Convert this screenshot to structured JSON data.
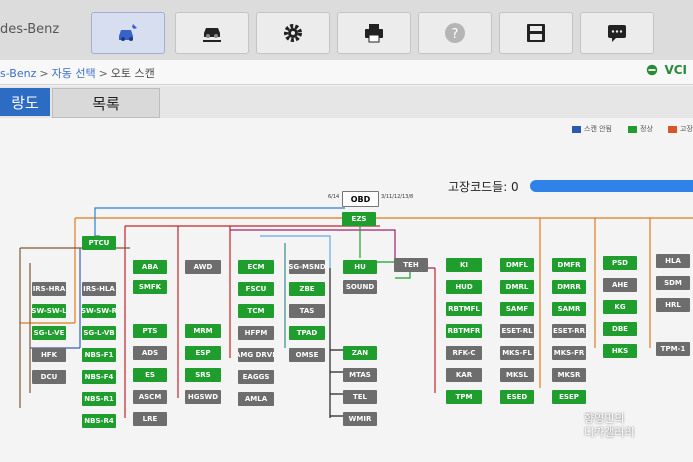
{
  "app": {
    "brand_text": "des-Benz"
  },
  "toolbar": {
    "buttons": [
      {
        "icon": "car-diagnostic-icon",
        "active": true
      },
      {
        "icon": "car-lift-icon",
        "active": false
      },
      {
        "icon": "gear-icon",
        "active": false
      },
      {
        "icon": "printer-icon",
        "active": false
      },
      {
        "icon": "help-icon",
        "active": false
      },
      {
        "icon": "save-icon",
        "active": false
      },
      {
        "icon": "chat-icon",
        "active": false
      }
    ]
  },
  "breadcrumb": {
    "items": [
      "s-Benz",
      "자동 선택",
      "오토 스캔"
    ],
    "separator": ">",
    "vci_label": "VCI"
  },
  "tabs": [
    {
      "label": "랑도"
    },
    {
      "label": "목록"
    }
  ],
  "fault_codes": {
    "label": "고장코드들: 0"
  },
  "legend": [
    {
      "label": "스캔 안됨",
      "color": "#2a5bb0"
    },
    {
      "label": "정상",
      "color": "#1f9e2e"
    },
    {
      "label": "고장",
      "color": "#d9552b"
    }
  ],
  "obd": {
    "label": "OBD",
    "left_pins": "6/14",
    "right_pins": "3/11/12/13/8"
  },
  "modules": [
    {
      "label": "EZS",
      "color": "g"
    },
    {
      "label": "PTCU",
      "color": "g"
    },
    {
      "label": "IRS-HRA",
      "color": "d"
    },
    {
      "label": "SW-SW-L",
      "color": "g"
    },
    {
      "label": "SG-L-VE",
      "color": "g"
    },
    {
      "label": "HFK",
      "color": "d"
    },
    {
      "label": "DCU",
      "color": "d"
    },
    {
      "label": "IRS-HLA",
      "color": "d"
    },
    {
      "label": "SW-SW-R",
      "color": "g"
    },
    {
      "label": "SG-L-VB",
      "color": "g"
    },
    {
      "label": "NBS-F1",
      "color": "g"
    },
    {
      "label": "NBS-F4",
      "color": "g"
    },
    {
      "label": "NBS-R1",
      "color": "g"
    },
    {
      "label": "NBS-R4",
      "color": "g"
    },
    {
      "label": "ABA",
      "color": "g"
    },
    {
      "label": "SMFK",
      "color": "g"
    },
    {
      "label": "PTS",
      "color": "g"
    },
    {
      "label": "ADS",
      "color": "d"
    },
    {
      "label": "ES",
      "color": "g"
    },
    {
      "label": "ASCM",
      "color": "d"
    },
    {
      "label": "LRE",
      "color": "d"
    },
    {
      "label": "AWD",
      "color": "d"
    },
    {
      "label": "MRM",
      "color": "g"
    },
    {
      "label": "ESP",
      "color": "g"
    },
    {
      "label": "SRS",
      "color": "g"
    },
    {
      "label": "HGSWD",
      "color": "d"
    },
    {
      "label": "ECM",
      "color": "g"
    },
    {
      "label": "FSCU",
      "color": "g"
    },
    {
      "label": "TCM",
      "color": "g"
    },
    {
      "label": "HFPM",
      "color": "d"
    },
    {
      "label": "AMG DRVE",
      "color": "d"
    },
    {
      "label": "EAGGS",
      "color": "d"
    },
    {
      "label": "AMLA",
      "color": "d"
    },
    {
      "label": "SG-MSND",
      "color": "d"
    },
    {
      "label": "ZBE",
      "color": "g"
    },
    {
      "label": "TAS",
      "color": "d"
    },
    {
      "label": "TPAD",
      "color": "g"
    },
    {
      "label": "OMSE",
      "color": "d"
    },
    {
      "label": "HU",
      "color": "g"
    },
    {
      "label": "SOUND",
      "color": "d"
    },
    {
      "label": "ZAN",
      "color": "g"
    },
    {
      "label": "MTAS",
      "color": "d"
    },
    {
      "label": "TEL",
      "color": "d"
    },
    {
      "label": "WMIR",
      "color": "d"
    },
    {
      "label": "TEH",
      "color": "d"
    },
    {
      "label": "KI",
      "color": "g"
    },
    {
      "label": "HUD",
      "color": "g"
    },
    {
      "label": "RBTMFL",
      "color": "g"
    },
    {
      "label": "RBTMFR",
      "color": "g"
    },
    {
      "label": "RFK-C",
      "color": "d"
    },
    {
      "label": "KAR",
      "color": "d"
    },
    {
      "label": "TPM",
      "color": "g"
    },
    {
      "label": "DMFL",
      "color": "g"
    },
    {
      "label": "DMRL",
      "color": "g"
    },
    {
      "label": "SAMF",
      "color": "g"
    },
    {
      "label": "ESET-RL",
      "color": "d"
    },
    {
      "label": "MKS-FL",
      "color": "d"
    },
    {
      "label": "MKSL",
      "color": "d"
    },
    {
      "label": "ESED",
      "color": "g"
    },
    {
      "label": "DMFR",
      "color": "g"
    },
    {
      "label": "DMRR",
      "color": "g"
    },
    {
      "label": "SAMR",
      "color": "g"
    },
    {
      "label": "ESET-RR",
      "color": "d"
    },
    {
      "label": "MKS-FR",
      "color": "d"
    },
    {
      "label": "MKSR",
      "color": "d"
    },
    {
      "label": "ESEP",
      "color": "g"
    },
    {
      "label": "PSD",
      "color": "g"
    },
    {
      "label": "AHE",
      "color": "d"
    },
    {
      "label": "KG",
      "color": "g"
    },
    {
      "label": "DBE",
      "color": "g"
    },
    {
      "label": "HKS",
      "color": "g"
    },
    {
      "label": "HLA",
      "color": "d"
    },
    {
      "label": "SDM",
      "color": "d"
    },
    {
      "label": "HRL",
      "color": "d"
    },
    {
      "label": "TPM-1",
      "color": "d"
    }
  ],
  "watermark": {
    "line1": "향영민의",
    "line2": "디카갤러리"
  }
}
